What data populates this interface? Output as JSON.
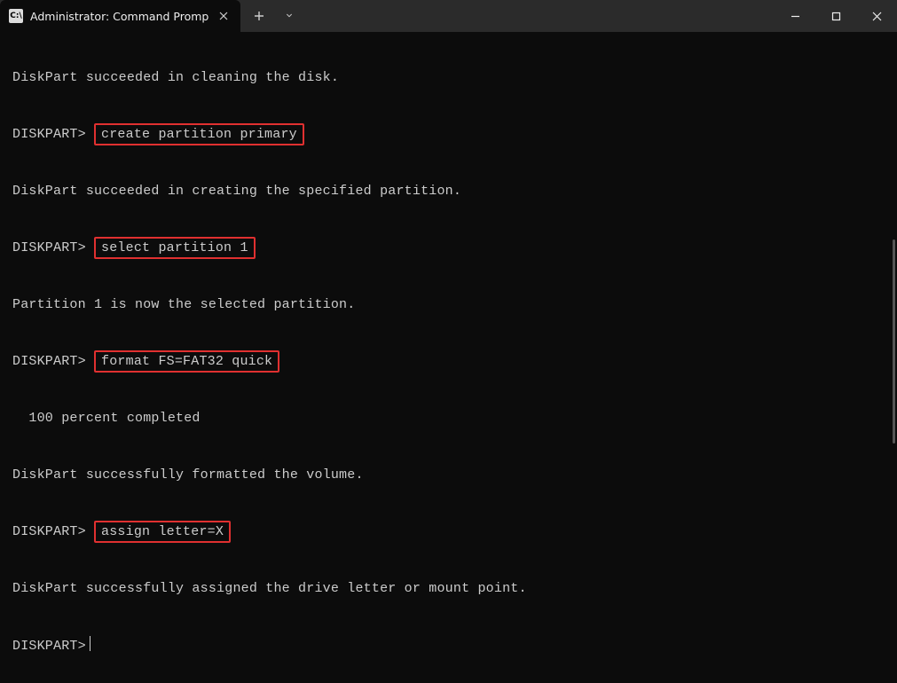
{
  "window": {
    "tab_title": "Administrator: Command Promp",
    "icons": {
      "tab": "cmd-icon",
      "close_tab": "close-icon",
      "new_tab": "plus-icon",
      "dropdown": "chevron-down-icon",
      "minimize": "minimize-icon",
      "maximize": "maximize-icon",
      "close": "close-icon"
    }
  },
  "terminal": {
    "prompt": "DISKPART>",
    "lines": {
      "l1": "DiskPart succeeded in cleaning the disk.",
      "cmd1": "create partition primary",
      "l2": "DiskPart succeeded in creating the specified partition.",
      "cmd2": "select partition 1",
      "l3": "Partition 1 is now the selected partition.",
      "cmd3": "format FS=FAT32 quick",
      "l4": "  100 percent completed",
      "l5": "DiskPart successfully formatted the volume.",
      "cmd4": "assign letter=X",
      "l6": "DiskPart successfully assigned the drive letter or mount point."
    }
  },
  "colors": {
    "highlight_border": "#e03030",
    "bg": "#0c0c0c",
    "titlebar": "#2b2b2b",
    "text": "#cccccc"
  }
}
